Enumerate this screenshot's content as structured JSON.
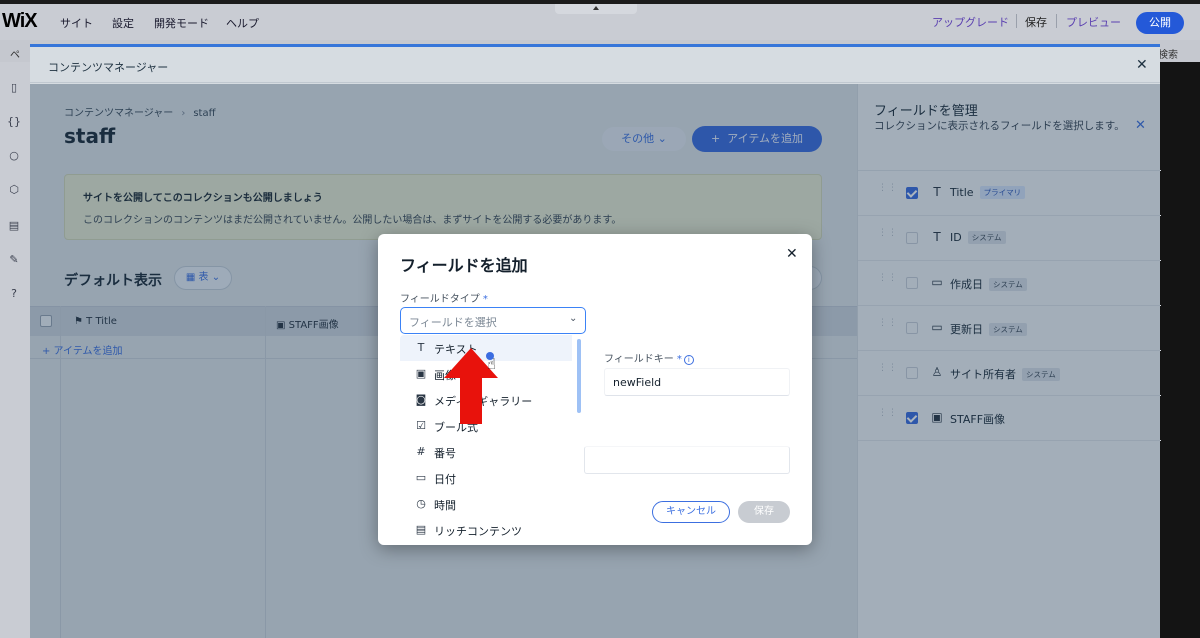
{
  "wix": {
    "logo": "WiX",
    "menu": [
      "サイト",
      "設定",
      "開発モード",
      "ヘルプ"
    ],
    "upgrade": "アップグレード",
    "save": "保存",
    "preview": "プレビュー",
    "publish": "公開",
    "page_abbr": "ペ",
    "search_tail": "検索"
  },
  "cm": {
    "title": "コンテンツマネージャー",
    "close": "✕",
    "breadcrumb_root": "コンテンツマネージャー",
    "breadcrumb_current": "staff",
    "collection_name": "staff",
    "more_label": "その他",
    "add_item_label": "アイテムを追加",
    "notice_title": "サイトを公開してこのコレクションも公開しましょう",
    "notice_text": "このコレクションのコンテンツはまだ公開されていません。公開したい場合は、まずサイトを公開する必要があります。",
    "view_title": "デフォルト表示",
    "view_toggle": "表",
    "columns": [
      "Title",
      "STAFF画像"
    ],
    "add_row": "+ アイテムを追加"
  },
  "manage_fields": {
    "title": "フィールドを管理",
    "subtitle": "コレクションに表示されるフィールドを選択します。",
    "fields": [
      {
        "icon": "text-icon",
        "glyph": "T",
        "name": "Title",
        "tag": "プライマリ",
        "checked": true,
        "primary": true
      },
      {
        "icon": "text-icon",
        "glyph": "T",
        "name": "ID",
        "tag": "システム",
        "checked": false,
        "primary": false
      },
      {
        "icon": "calendar-icon",
        "glyph": "▭",
        "name": "作成日",
        "tag": "システム",
        "checked": false,
        "primary": false
      },
      {
        "icon": "calendar-edit-icon",
        "glyph": "▭",
        "name": "更新日",
        "tag": "システム",
        "checked": false,
        "primary": false
      },
      {
        "icon": "person-icon",
        "glyph": "♙",
        "name": "サイト所有者",
        "tag": "システム",
        "checked": false,
        "primary": false
      },
      {
        "icon": "image-icon",
        "glyph": "▣",
        "name": "STAFF画像",
        "tag": "",
        "checked": true,
        "primary": false
      }
    ]
  },
  "dialog": {
    "title": "フィールドを追加",
    "field_type_label": "フィールドタイプ",
    "required_mark": "*",
    "select_placeholder": "フィールドを選択",
    "field_key_label": "フィールドキー",
    "field_key_value": "newField",
    "cancel": "キャンセル",
    "save": "保存",
    "types": [
      {
        "icon": "text-icon",
        "glyph": "T",
        "label": "テキスト"
      },
      {
        "icon": "image-icon",
        "glyph": "▣",
        "label": "画像"
      },
      {
        "icon": "media-gallery-icon",
        "glyph": "◙",
        "label": "メディアギャラリー"
      },
      {
        "icon": "boolean-icon",
        "glyph": "☑",
        "label": "ブール式"
      },
      {
        "icon": "number-icon",
        "glyph": "#",
        "label": "番号"
      },
      {
        "icon": "date-icon",
        "glyph": "▭",
        "label": "日付"
      },
      {
        "icon": "time-icon",
        "glyph": "◷",
        "label": "時間"
      },
      {
        "icon": "rich-content-icon",
        "glyph": "▤",
        "label": "リッチコンテンツ"
      }
    ]
  },
  "colors": {
    "accent": "#3b6ce0",
    "annotation_arrow": "#e8120c"
  }
}
